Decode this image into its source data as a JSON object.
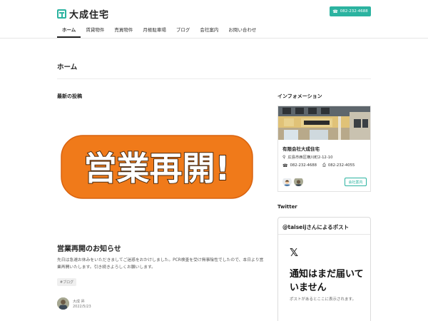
{
  "header": {
    "logo_text": "大成住宅",
    "phone": "082-232-4688",
    "nav": [
      {
        "label": "ホーム",
        "active": true
      },
      {
        "label": "賃貸物件",
        "active": false
      },
      {
        "label": "売買物件",
        "active": false
      },
      {
        "label": "月極駐車場",
        "active": false
      },
      {
        "label": "ブログ",
        "active": false
      },
      {
        "label": "会社案内",
        "active": false
      },
      {
        "label": "お問い合わせ",
        "active": false
      }
    ]
  },
  "page": {
    "title": "ホーム"
  },
  "main": {
    "section_title": "最新の投稿",
    "post": {
      "image_text": "営業再開!",
      "title": "営業再開のお知らせ",
      "excerpt": "先日は急遽お休みをいただきましてご迷惑をおかけしました。PCR検査を受け無事陰性でしたので、本日より営業再開いたします。引き続きよろしくお願いします。",
      "tag": "#ブログ",
      "author": "大成 昇",
      "date": "2022/5/23"
    }
  },
  "sidebar": {
    "info_title": "インフォメーション",
    "company_name": "有限会社大成住宅",
    "address": "広島市西区横川町2-12-10",
    "tel": "082-232-4688",
    "fax": "082-232-4055",
    "company_button": "会社案内",
    "twitter_title": "Twitter",
    "twitter": {
      "header": "@taiseijさんによるポスト",
      "message": "通知はまだ届いていません",
      "sub": "ポストがあるとここに表示されます。"
    }
  },
  "colors": {
    "accent": "#2bb3a0",
    "banner_orange": "#f07a1a",
    "banner_text": "#ffffff"
  }
}
